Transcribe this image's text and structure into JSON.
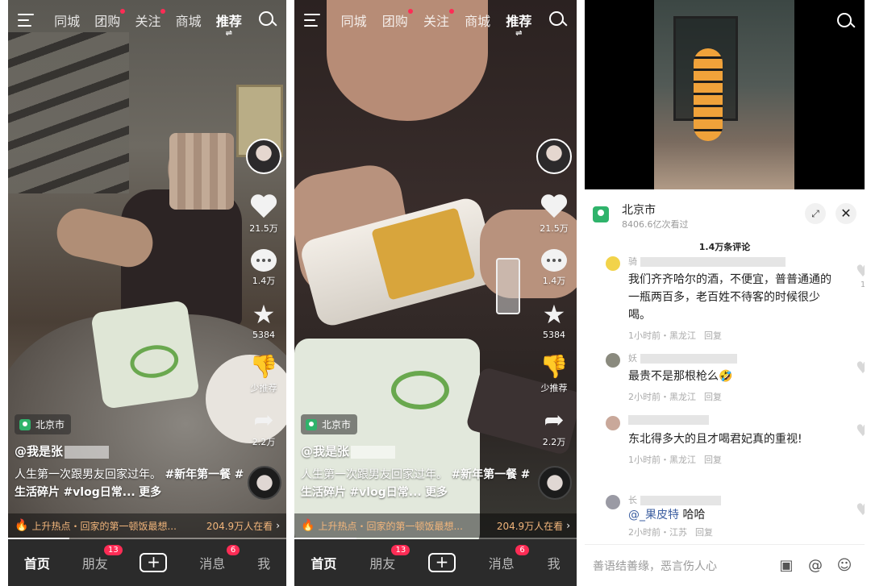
{
  "top_nav": {
    "tabs": [
      "同城",
      "团购",
      "关注",
      "商城",
      "推荐"
    ],
    "active_tab": "推荐"
  },
  "panel1": {
    "actions": {
      "likes": "21.5万",
      "comments": "1.4万",
      "favorites": "5384",
      "dislike": "少推荐",
      "shares": "2.2万"
    },
    "location": "北京市",
    "author": "@我是张",
    "desc_text": "人生第一次跟男友回家过年。",
    "hashtags": [
      "#新年第一餐",
      "#生活碎片",
      "#vlog日常..."
    ],
    "more": "更多",
    "hot": {
      "text": "上升热点・回家的第一顿饭最想...",
      "count": "204.9万人在看"
    },
    "progress": 0.22
  },
  "panel2": {
    "actions": {
      "likes": "21.5万",
      "comments": "1.4万",
      "favorites": "5384",
      "dislike": "少推荐",
      "shares": "2.2万"
    },
    "location": "北京市",
    "author": "@我是张",
    "desc_text": "人生第一次跟男友回家过年。",
    "hashtags": [
      "#新年第一餐",
      "#生活碎片",
      "#vlog日常..."
    ],
    "more": "更多",
    "hot": {
      "text": "上升热点・回家的第一顿饭最想...",
      "count": "204.9万人在看"
    },
    "progress": 0.22
  },
  "bottom_nav": {
    "home": "首页",
    "friends": "朋友",
    "friends_badge": "13",
    "add": "+",
    "messages": "消息",
    "messages_badge": "6",
    "me": "我"
  },
  "comments_panel": {
    "city": "北京市",
    "views": "8406.6亿次看过",
    "count_title": "1.4万条评论",
    "comments": [
      {
        "name": "骑",
        "text": "我们齐齐哈尔的酒，不便宜，普普通通的一瓶两百多，老百姓不待客的时候很少喝。",
        "time": "1小时前・黑龙江",
        "reply": "回复",
        "likes": "1"
      },
      {
        "name": "妖",
        "text": "最贵不是那根枪么🤣",
        "time": "2小时前・黑龙江",
        "reply": "回复",
        "likes": ""
      },
      {
        "name": "",
        "text": "东北得多大的且才喝君妃真的重视!",
        "time": "1小时前・黑龙江",
        "reply": "回复",
        "likes": ""
      },
      {
        "name": "长",
        "mention": "@_果皮特",
        "text": " 哈哈",
        "time": "2小时前・江苏",
        "reply": "回复",
        "likes": ""
      }
    ],
    "input_placeholder": "善语结善缘，恶言伤人心"
  },
  "colors": {
    "accent": "#fe2c55",
    "location_green": "#2fb36b",
    "hot_orange": "#f1b57b"
  }
}
